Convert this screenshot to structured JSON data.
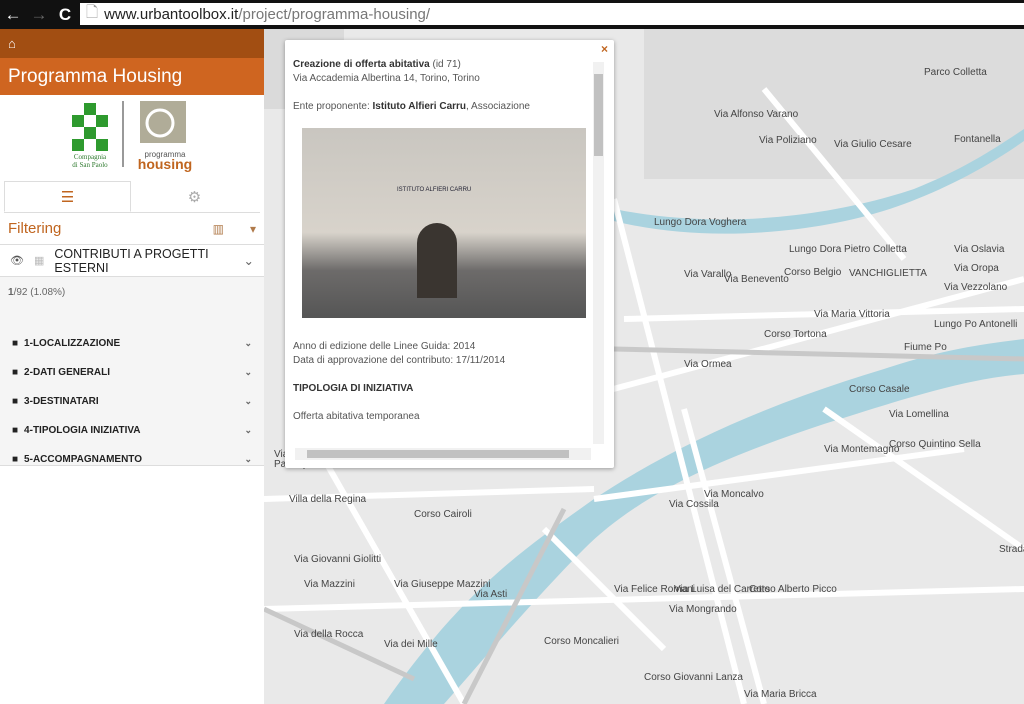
{
  "browser": {
    "url_host": "www.urbantoolbox.it",
    "url_path": "/project/programma-housing/",
    "back": "←",
    "forward": "→",
    "reload": "C"
  },
  "sidebar": {
    "home_icon": "home-icon",
    "title": "Programma Housing",
    "logos": {
      "left": "Compagnia di San Paolo",
      "right_small": "programma",
      "right_big": "housing"
    },
    "tabs": [
      {
        "icon": "sliders-icon",
        "glyph": "☰"
      },
      {
        "icon": "gear-icon",
        "glyph": "⚙"
      }
    ],
    "filtering": {
      "label": "Filtering",
      "chart_glyph": "📊",
      "caret": "▾"
    },
    "contrib": {
      "label": "CONTRIBUTI A PROGETTI ESTERNI",
      "eye": "👁",
      "grid": "▦",
      "chev": "⌄"
    },
    "count": {
      "selected": "1",
      "rest": "/92 (1.08%)"
    },
    "categories": [
      {
        "label": "1-LOCALIZZAZIONE"
      },
      {
        "label": "2-DATI GENERALI"
      },
      {
        "label": "3-DESTINATARI"
      },
      {
        "label": "4-TIPOLOGIA INIZIATIVA"
      },
      {
        "label": "5-ACCOMPAGNAMENTO"
      }
    ]
  },
  "popup": {
    "close": "×",
    "title": "Creazione di offerta abitativa",
    "id": "(id 71)",
    "address": "Via Accademia Albertina 14, Torino, Torino",
    "ente_label": "Ente proponente:",
    "ente_name": "Istituto Alfieri Carru",
    "ente_type": ", Associazione",
    "photo_sign": "ISTITUTO ALFIERI CARRU",
    "anno": "Anno di edizione delle Linee Guida: 2014",
    "data": "Data di approvazione del contributo: 17/11/2014",
    "section": "TIPOLOGIA DI INIZIATIVA",
    "tipologia": "Offerta abitativa temporanea"
  },
  "map": {
    "colors": {
      "water": "#aad3df",
      "road": "#ffffff",
      "land": "#e9e9e9"
    },
    "labels": [
      "Parco Colletta",
      "Via Alfonso Varano",
      "Via Poliziano",
      "Via Giulio Cesare",
      "Fontanella",
      "Lungo Dora Voghera",
      "Lungo Dora Pietro Colletta",
      "Corso Belgio",
      "Via Oslavia",
      "VANCHIGLIETTA",
      "Via Oropa",
      "Via Vezzolano",
      "Lungo Po Antonelli",
      "Fiume Po",
      "Corso Casale",
      "Via Lomellina",
      "Via Montemagno",
      "Corso Quintino Sella",
      "Via Moncalvo",
      "Strada Comunale Val S. Martino",
      "Corso Alberto Picco",
      "Via Luisa del Carretto",
      "Via Felice Romani",
      "Via Asti",
      "Corso Moncalieri",
      "Corso Giovanni Lanza",
      "Villa della Regina",
      "Via Giovanni Giolitti",
      "Via Mazzini",
      "Via Giuseppe Mazzini",
      "Via dei Mille",
      "Via della Rocca",
      "Corso Cairoli",
      "Via Ormea",
      "Via Maria Vittoria",
      "Corso Tortona",
      "Via Benevento",
      "Via Varallo",
      "Via Cossila",
      "Via Mongrando",
      "Via Maria Bricca",
      "Via Torino",
      "Parco pubblico di"
    ]
  }
}
